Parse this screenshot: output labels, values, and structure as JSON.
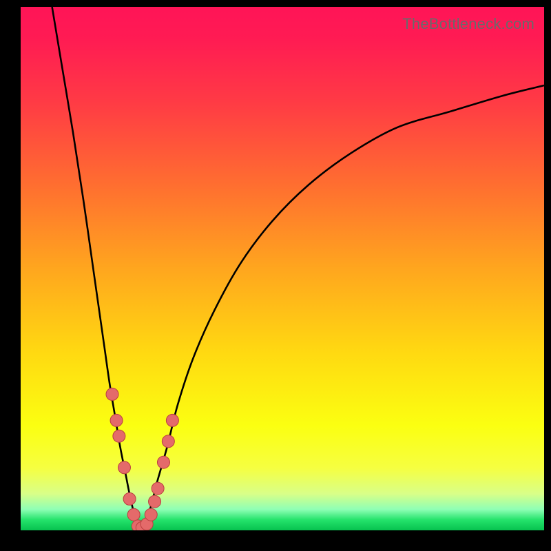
{
  "watermark": "TheBottleneck.com",
  "chart_data": {
    "type": "line",
    "title": "",
    "xlabel": "",
    "ylabel": "",
    "xlim": [
      0,
      100
    ],
    "ylim": [
      0,
      100
    ],
    "note": "No axes, ticks, or labels are rendered. Values are estimated from pixel positions; y represents bottleneck percentage (green near 0, red near 100).",
    "series": [
      {
        "name": "left-curve",
        "x": [
          6,
          8,
          10,
          12,
          14,
          15,
          16,
          17,
          18,
          19,
          20,
          21,
          22,
          23
        ],
        "y": [
          100,
          88,
          76,
          63,
          49,
          42,
          35,
          28,
          22,
          16,
          11,
          6,
          2,
          0
        ]
      },
      {
        "name": "right-curve",
        "x": [
          23,
          24,
          25,
          26,
          28,
          30,
          33,
          37,
          42,
          48,
          55,
          63,
          72,
          82,
          92,
          100
        ],
        "y": [
          0,
          2,
          5,
          9,
          16,
          24,
          33,
          42,
          51,
          59,
          66,
          72,
          77,
          80,
          83,
          85
        ]
      }
    ],
    "markers": {
      "name": "data-points",
      "color": "#e46a6a",
      "stroke": "#b93f3f",
      "radius_px": 9,
      "points_xy": [
        [
          17.5,
          26
        ],
        [
          18.3,
          21
        ],
        [
          18.8,
          18
        ],
        [
          19.8,
          12
        ],
        [
          20.8,
          6
        ],
        [
          21.6,
          3
        ],
        [
          22.4,
          0.8
        ],
        [
          23.2,
          0.5
        ],
        [
          24.1,
          1.2
        ],
        [
          24.9,
          3.0
        ],
        [
          25.6,
          5.5
        ],
        [
          26.2,
          8.0
        ],
        [
          27.3,
          13
        ],
        [
          28.2,
          17
        ],
        [
          29.0,
          21
        ]
      ]
    },
    "gradient_stops": [
      {
        "pct": 0,
        "color": "#ff1457"
      },
      {
        "pct": 18,
        "color": "#ff3a45"
      },
      {
        "pct": 34,
        "color": "#ff6e30"
      },
      {
        "pct": 50,
        "color": "#ffa61e"
      },
      {
        "pct": 66,
        "color": "#ffd911"
      },
      {
        "pct": 80,
        "color": "#fbff11"
      },
      {
        "pct": 93,
        "color": "#d9ff88"
      },
      {
        "pct": 100,
        "color": "#07c24f"
      }
    ]
  }
}
